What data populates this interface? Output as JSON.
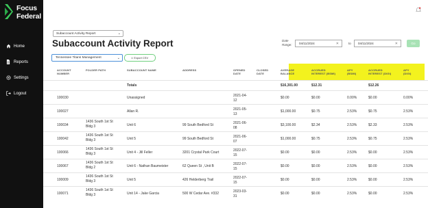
{
  "brand": {
    "line1": "Focus",
    "line2": "Federal",
    "accent": "#3bc95a"
  },
  "nav": [
    {
      "label": "Home",
      "icon": "home-icon"
    },
    {
      "label": "Reports",
      "icon": "document-icon"
    },
    {
      "label": "Settings",
      "icon": "gear-icon"
    },
    {
      "label": "Logout",
      "icon": "logout-icon"
    }
  ],
  "report_select": {
    "value": "Subaccount Activity Report"
  },
  "page_title": "Subaccount Activity Report",
  "manager_select": {
    "value": "Tennessee Titans Management"
  },
  "export_button": "Export CSV",
  "date_range": {
    "label1": "Date",
    "label2": "Range:",
    "from": "04/11/2024",
    "to_label": "to",
    "to": "04/11/2024",
    "go_label": "Go"
  },
  "highlight_color": "#f3f21e",
  "table": {
    "headers": [
      [
        "ACCOUNT",
        "NUMBER"
      ],
      [
        "FOLDER PATH"
      ],
      [
        "SUBACCOUNT NAME"
      ],
      [
        "ADDRESS"
      ],
      [
        "OPENED",
        "DATE"
      ],
      [
        "CLOSED",
        "DATE"
      ],
      [
        "AVERAGE",
        "BALANCE"
      ],
      [
        "ACCRUED",
        "INTEREST (BSMI)"
      ],
      [
        "APY",
        "(BSMI)"
      ],
      [
        "ACCRUED",
        "INTEREST (DIGI)"
      ],
      [
        "APY",
        "(DIGI)"
      ]
    ],
    "totals": {
      "label": "Totals",
      "avg_balance": "$16,301.00",
      "accrued_bsmi": "$12.31",
      "accrued_digi": "$12.26"
    },
    "rows": [
      {
        "acct": "100030",
        "folder": [],
        "name": "Unassigned",
        "address": "",
        "opened": [
          "2021-04-",
          "12"
        ],
        "closed": "",
        "avg": "$0.00",
        "acc_bsmi": "$0.00",
        "apy_bsmi": "0.00%",
        "acc_digi": "$0.00",
        "apy_digi": "0.00%"
      },
      {
        "acct": "100027",
        "folder": [],
        "name": "Allan R.",
        "address": "",
        "opened": [
          "2021-05-",
          "13"
        ],
        "closed": "",
        "avg": "$1,000.00",
        "acc_bsmi": "$0.75",
        "apy_bsmi": "2.53%",
        "acc_digi": "$0.75",
        "apy_digi": "2.53%"
      },
      {
        "acct": "100034",
        "folder": [
          "1436 South 1st St",
          "Bldg 3"
        ],
        "name": "Unit 6",
        "address": "99 South Bedford St",
        "opened": [
          "2021-06-",
          "08"
        ],
        "closed": "",
        "avg": "$3,100.00",
        "acc_bsmi": "$2.34",
        "apy_bsmi": "2.53%",
        "acc_digi": "$2.33",
        "apy_digi": "2.53%"
      },
      {
        "acct": "100042",
        "folder": [
          "1436 South 1st St",
          "Bldg 3"
        ],
        "name": "Unit 5",
        "address": "99 South Bedford St",
        "opened": [
          "2021-06-",
          "07"
        ],
        "closed": "",
        "avg": "$1,000.00",
        "acc_bsmi": "$0.75",
        "apy_bsmi": "2.53%",
        "acc_digi": "$0.75",
        "apy_digi": "2.53%"
      },
      {
        "acct": "100066",
        "folder": [
          "1436 South 1st St",
          "Bldg 3"
        ],
        "name": "Unit 4 - Jill Feller",
        "address": "3201 Crystal Park Court",
        "opened": [
          "2022-07-",
          "15"
        ],
        "closed": "",
        "avg": "$0.00",
        "acc_bsmi": "$0.00",
        "apy_bsmi": "2.53%",
        "acc_digi": "$0.00",
        "apy_digi": "2.53%"
      },
      {
        "acct": "100067",
        "folder": [
          "1436 South 1st St",
          "Bldg 2"
        ],
        "name": "Unit 6 - Nathan Baumeister",
        "address": "62 Queen St , Unit B",
        "opened": [
          "2022-07-",
          "15"
        ],
        "closed": "",
        "avg": "$0.00",
        "acc_bsmi": "$0.00",
        "apy_bsmi": "2.53%",
        "acc_digi": "$0.00",
        "apy_digi": "2.53%"
      },
      {
        "acct": "100009",
        "folder": [
          "1436 South 1st St",
          "Bldg 3"
        ],
        "name": "Unit 5",
        "address": "426 Helderberg Trail",
        "opened": [
          "2022-07-",
          "15"
        ],
        "closed": "",
        "avg": "$0.00",
        "acc_bsmi": "$0.00",
        "apy_bsmi": "2.53%",
        "acc_digi": "$0.00",
        "apy_digi": "2.53%"
      },
      {
        "acct": "100071",
        "folder": [
          "1436 South 1st St",
          "Bldg 3"
        ],
        "name": "Unit 14 - Jake Garcia",
        "address": "500 W Cedar Ave. #332",
        "opened": [
          "2023-03-",
          "31"
        ],
        "closed": "",
        "avg": "$0.00",
        "acc_bsmi": "$0.00",
        "apy_bsmi": "2.53%",
        "acc_digi": "$0.00",
        "apy_digi": "2.53%"
      }
    ]
  }
}
